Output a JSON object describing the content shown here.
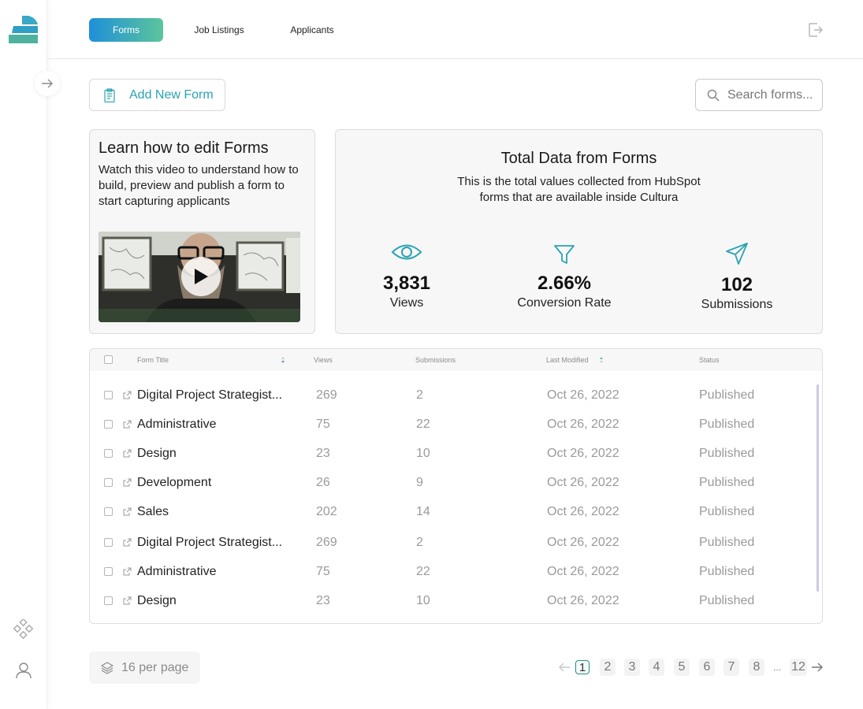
{
  "nav": {
    "tabs": [
      {
        "label": "Forms"
      },
      {
        "label": "Job Listings"
      },
      {
        "label": "Applicants"
      }
    ]
  },
  "actions": {
    "add_label": "Add New Form",
    "search_placeholder": "Search forms..."
  },
  "learn_card": {
    "title": "Learn how to edit Forms",
    "body": "Watch this video to understand how to build, preview and publish a form to start capturing applicants"
  },
  "total_card": {
    "title": "Total Data from Forms",
    "description": "This is the total values collected from HubSpot forms that are available inside Cultura",
    "stats": [
      {
        "value": "3,831",
        "label": "Views",
        "icon": "eye-icon"
      },
      {
        "value": "2.66%",
        "label": "Conversion Rate",
        "icon": "filter-icon"
      },
      {
        "value": "102",
        "label": "Submissions",
        "icon": "send-icon"
      }
    ]
  },
  "table": {
    "columns": [
      "Form Title",
      "Views",
      "Submissions",
      "Last Modified",
      "Status"
    ],
    "rows": [
      {
        "title": "Digital Project Strategist...",
        "views": "269",
        "submissions": "2",
        "modified": "Oct 26, 2022",
        "status": "Published"
      },
      {
        "title": "Administrative",
        "views": "75",
        "submissions": "22",
        "modified": "Oct 26, 2022",
        "status": "Published"
      },
      {
        "title": "Design",
        "views": "23",
        "submissions": "10",
        "modified": "Oct 26, 2022",
        "status": "Published"
      },
      {
        "title": "Development",
        "views": "26",
        "submissions": "9",
        "modified": "Oct 26, 2022",
        "status": "Published"
      },
      {
        "title": "Sales",
        "views": "202",
        "submissions": "14",
        "modified": "Oct 26, 2022",
        "status": "Published"
      },
      {
        "title": "Digital Project Strategist...",
        "views": "269",
        "submissions": "2",
        "modified": "Oct 26, 2022",
        "status": "Published"
      },
      {
        "title": "Administrative",
        "views": "75",
        "submissions": "22",
        "modified": "Oct 26, 2022",
        "status": "Published"
      },
      {
        "title": "Design",
        "views": "23",
        "submissions": "10",
        "modified": "Oct 26, 2022",
        "status": "Published"
      }
    ]
  },
  "footer": {
    "per_page": "16 per page",
    "pages": [
      "1",
      "2",
      "3",
      "4",
      "5",
      "6",
      "7",
      "8"
    ],
    "ellipsis": "...",
    "last_page": "12",
    "current_page": "1"
  },
  "colors": {
    "accent_start": "#1f8fd9",
    "accent_end": "#5cc59a",
    "teal": "#2aa3b3"
  }
}
